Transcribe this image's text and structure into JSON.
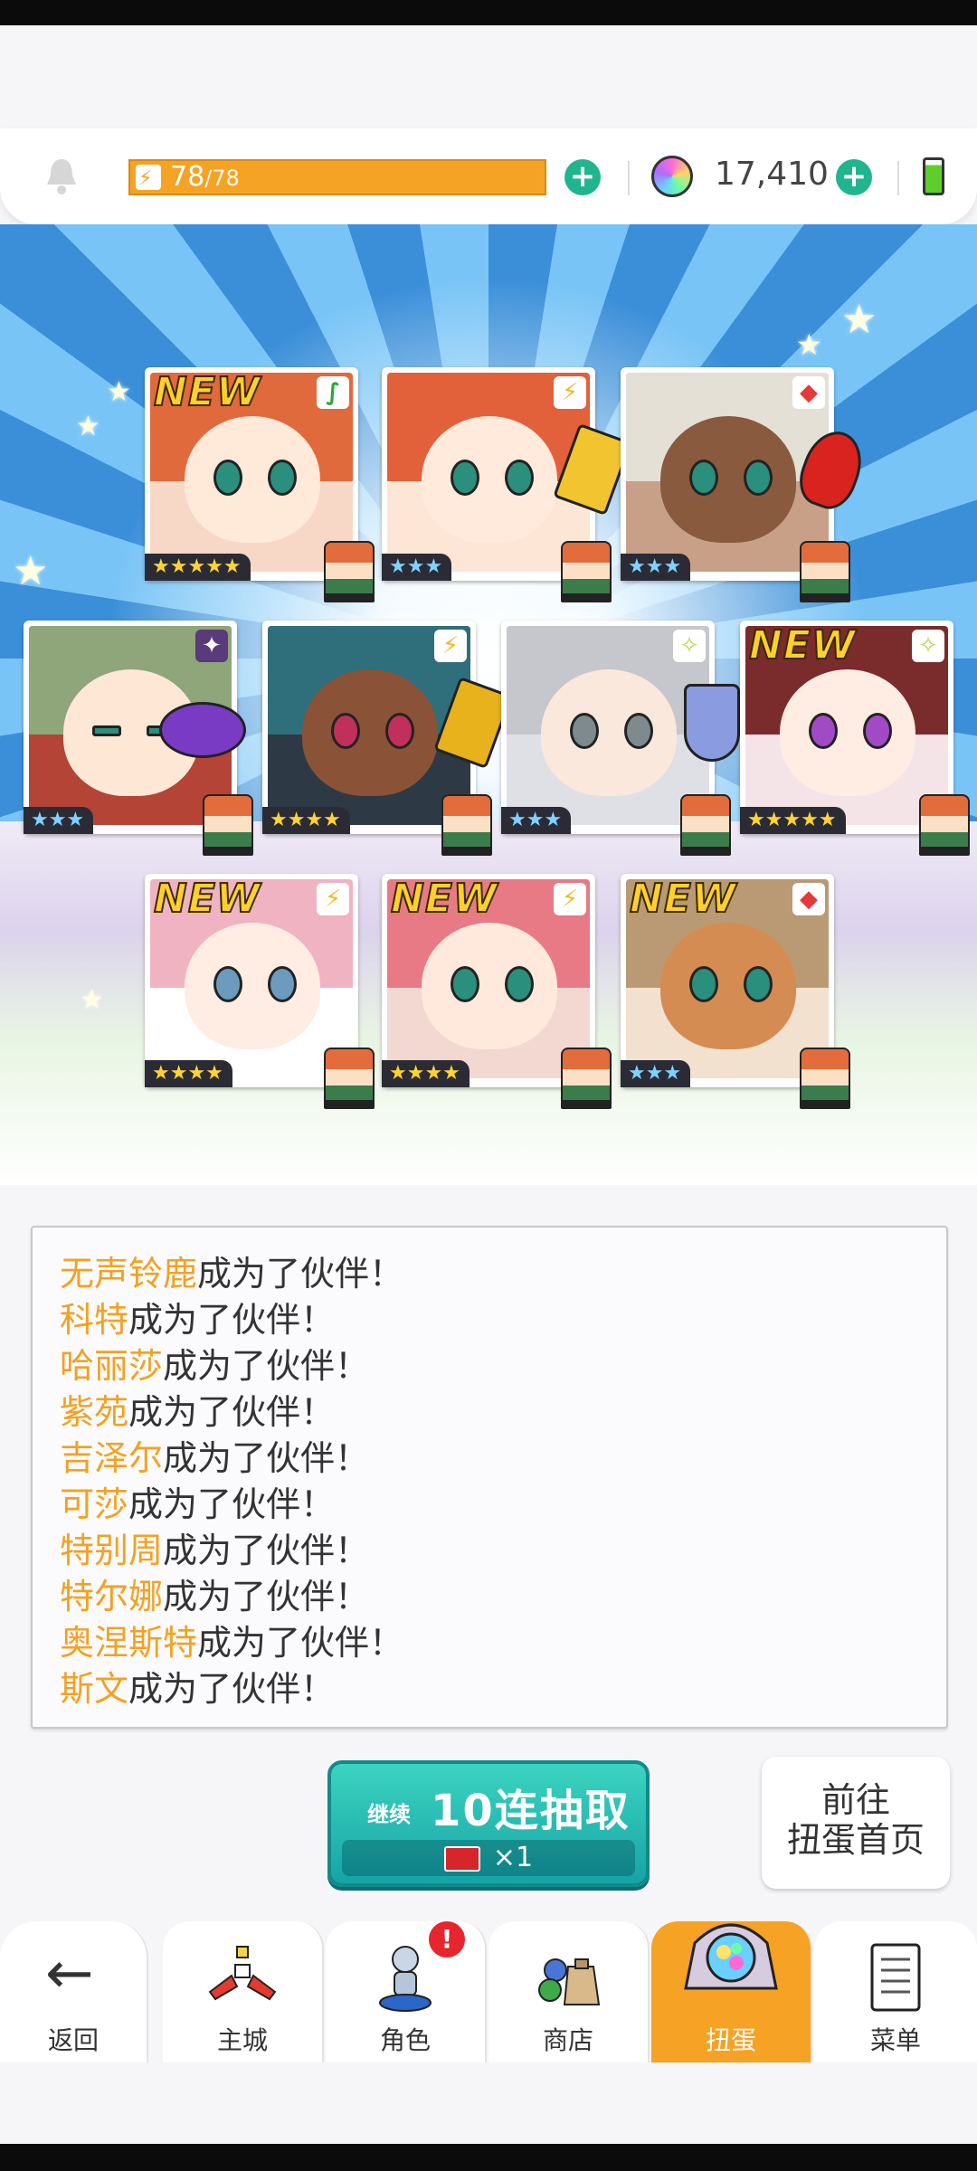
{
  "header": {
    "stamina_current": "78",
    "stamina_max": "/78",
    "gems": "17,410",
    "colors": {
      "stamina_bar": "#f5a325",
      "plus_button": "#20b58e"
    }
  },
  "cards": [
    {
      "is_new": true,
      "new_label": "NEW",
      "attribute_icon": "leaf-icon",
      "attribute_glyph": "∫",
      "stars": "★★★★★",
      "rarity": 5
    },
    {
      "is_new": false,
      "new_label": "",
      "attribute_icon": "bolt-icon",
      "attribute_glyph": "⚡",
      "stars": "★★★",
      "rarity": 3
    },
    {
      "is_new": false,
      "new_label": "",
      "attribute_icon": "diamonds-icon",
      "attribute_glyph": "◆",
      "stars": "★★★",
      "rarity": 3
    },
    {
      "is_new": false,
      "new_label": "",
      "attribute_icon": "star4-icon",
      "attribute_glyph": "✦",
      "stars": "★★★",
      "rarity": 3
    },
    {
      "is_new": false,
      "new_label": "",
      "attribute_icon": "bolt-icon",
      "attribute_glyph": "⚡",
      "stars": "★★★★",
      "rarity": 4
    },
    {
      "is_new": false,
      "new_label": "",
      "attribute_icon": "sparkle-icon",
      "attribute_glyph": "✧",
      "stars": "★★★",
      "rarity": 3
    },
    {
      "is_new": true,
      "new_label": "NEW",
      "attribute_icon": "sparkle-icon",
      "attribute_glyph": "✧",
      "stars": "★★★★★",
      "rarity": 5
    },
    {
      "is_new": true,
      "new_label": "NEW",
      "attribute_icon": "bolt-icon",
      "attribute_glyph": "⚡",
      "stars": "★★★★",
      "rarity": 4
    },
    {
      "is_new": true,
      "new_label": "NEW",
      "attribute_icon": "bolt-icon",
      "attribute_glyph": "⚡",
      "stars": "★★★★",
      "rarity": 4
    },
    {
      "is_new": true,
      "new_label": "NEW",
      "attribute_icon": "diamonds-icon",
      "attribute_glyph": "◆",
      "stars": "★★★",
      "rarity": 3
    }
  ],
  "log": {
    "suffix": "成为了伙伴！",
    "entries": [
      {
        "name": "无声铃鹿"
      },
      {
        "name": "科特"
      },
      {
        "name": "哈丽莎"
      },
      {
        "name": "紫苑"
      },
      {
        "name": "吉泽尔"
      },
      {
        "name": "可莎"
      },
      {
        "name": "特别周"
      },
      {
        "name": "特尔娜"
      },
      {
        "name": "奥涅斯特"
      },
      {
        "name": "斯文"
      }
    ]
  },
  "draw_button": {
    "continue_label": "继续",
    "main_label": "10连抽取",
    "cost": "×1"
  },
  "home_button": {
    "line1": "前往",
    "line2": "扭蛋首页"
  },
  "nav": {
    "back": "返回",
    "tabs": [
      {
        "label": "主城",
        "icon": "castle-icon"
      },
      {
        "label": "角色",
        "icon": "character-icon",
        "alert": "!"
      },
      {
        "label": "商店",
        "icon": "shop-bag-icon"
      },
      {
        "label": "扭蛋",
        "icon": "gacha-orb-icon",
        "active": true
      },
      {
        "label": "菜单",
        "icon": "menu-list-icon"
      }
    ]
  }
}
